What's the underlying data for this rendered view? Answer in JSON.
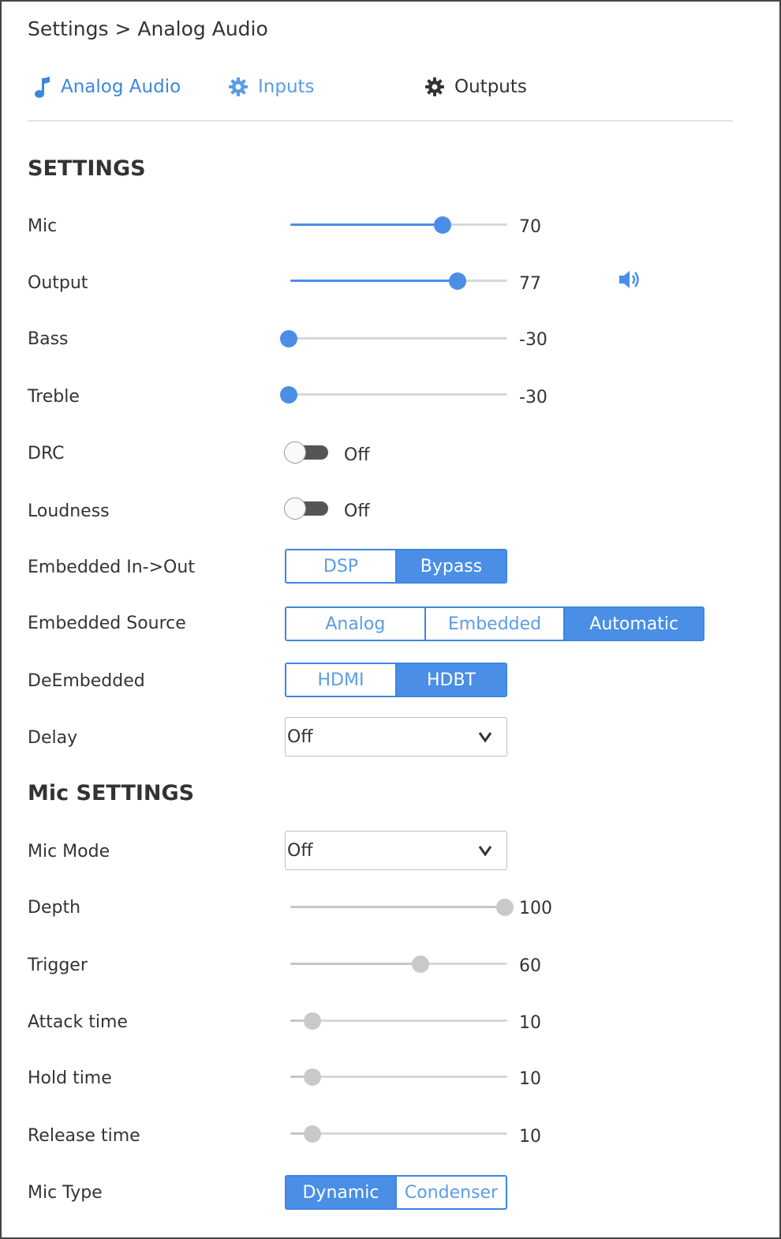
{
  "breadcrumb": {
    "root": "Settings",
    "separator": ">",
    "current": "Analog Audio"
  },
  "tabs": [
    {
      "label": "Analog Audio",
      "icon": "music-note-icon"
    },
    {
      "label": "Inputs",
      "icon": "gear-icon"
    },
    {
      "label": "Outputs",
      "icon": "gear-icon"
    }
  ],
  "colors": {
    "accent": "#4a8ee6",
    "text": "#333333",
    "disabled": "#c9c9c9"
  },
  "settings": {
    "title": "SETTINGS",
    "mic": {
      "label": "Mic",
      "value": "70",
      "fraction": 0.7
    },
    "output": {
      "label": "Output",
      "value": "77",
      "fraction": 0.77,
      "icon": "speaker-icon"
    },
    "bass": {
      "label": "Bass",
      "value": "-30",
      "fraction": 0.0
    },
    "treble": {
      "label": "Treble",
      "value": "-30",
      "fraction": 0.0
    },
    "drc": {
      "label": "DRC",
      "state": "Off"
    },
    "loudness": {
      "label": "Loudness",
      "state": "Off"
    },
    "embedded_in_out": {
      "label": "Embedded In->Out",
      "options": [
        "DSP",
        "Bypass"
      ],
      "selected": "Bypass"
    },
    "embedded_source": {
      "label": "Embedded Source",
      "options": [
        "Analog",
        "Embedded",
        "Automatic"
      ],
      "selected": "Automatic"
    },
    "deembedded": {
      "label": "DeEmbedded",
      "options": [
        "HDMI",
        "HDBT"
      ],
      "selected": "HDBT"
    },
    "delay": {
      "label": "Delay",
      "value": "Off"
    }
  },
  "mic_settings": {
    "title": "Mic SETTINGS",
    "mic_mode": {
      "label": "Mic Mode",
      "value": "Off"
    },
    "depth": {
      "label": "Depth",
      "value": "100",
      "fraction": 1.0
    },
    "trigger": {
      "label": "Trigger",
      "value": "60",
      "fraction": 0.6
    },
    "attack_time": {
      "label": "Attack time",
      "value": "10",
      "fraction": 0.1
    },
    "hold_time": {
      "label": "Hold time",
      "value": "10",
      "fraction": 0.1
    },
    "release_time": {
      "label": "Release time",
      "value": "10",
      "fraction": 0.1
    },
    "mic_type": {
      "label": "Mic Type",
      "options": [
        "Dynamic",
        "Condenser"
      ],
      "selected": "Dynamic"
    }
  }
}
